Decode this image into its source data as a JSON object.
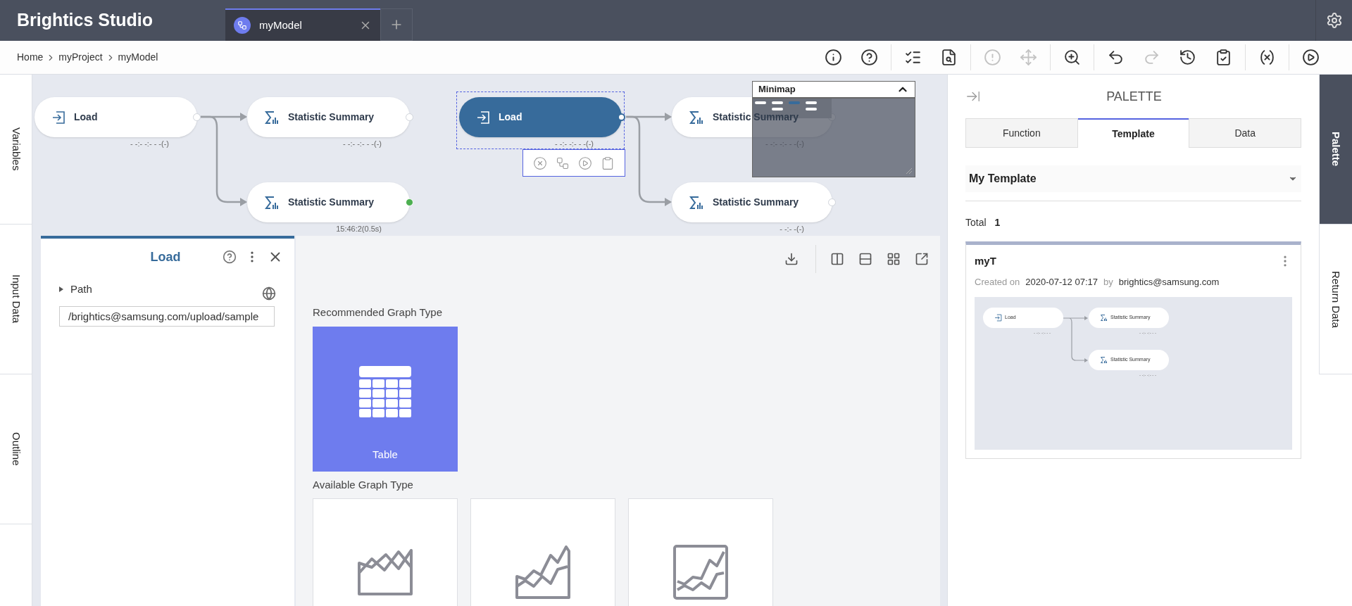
{
  "app": {
    "title": "Brightics Studio"
  },
  "tabs": [
    {
      "label": "myModel",
      "selected": true
    }
  ],
  "breadcrumb": [
    "Home",
    "myProject",
    "myModel"
  ],
  "toolbar": [
    [
      {
        "kind": "info",
        "disabled": false
      },
      {
        "kind": "help",
        "disabled": false
      }
    ],
    [
      {
        "kind": "checklist",
        "disabled": false
      },
      {
        "kind": "inspect",
        "disabled": false
      }
    ],
    [
      {
        "kind": "alert",
        "disabled": true
      },
      {
        "kind": "move",
        "disabled": true
      }
    ],
    [
      {
        "kind": "zoom",
        "disabled": false
      }
    ],
    [
      {
        "kind": "undo",
        "disabled": false
      },
      {
        "kind": "redo",
        "disabled": true
      },
      {
        "kind": "history",
        "disabled": false
      },
      {
        "kind": "clipboard",
        "disabled": false
      }
    ],
    [
      {
        "kind": "variable",
        "disabled": false
      }
    ],
    [
      {
        "kind": "run",
        "disabled": false
      }
    ]
  ],
  "left_tabs": [
    {
      "label": "Variables",
      "selected": false
    },
    {
      "label": "Input Data",
      "selected": false
    },
    {
      "label": "Outline",
      "selected": false
    }
  ],
  "right_tabs": [
    {
      "label": "Palette",
      "selected": true
    },
    {
      "label": "Return Data",
      "selected": false
    }
  ],
  "canvas": {
    "nodes": [
      {
        "kind": "load",
        "label": "Load",
        "time": "- -:- -:- - -(-)",
        "selected": false,
        "executed": false
      },
      {
        "kind": "statistic",
        "label": "Statistic Summary",
        "time": "- -:- -:- - -(-)",
        "selected": false,
        "executed": false
      },
      {
        "kind": "statistic",
        "label": "Statistic Summary",
        "time": "15:46:2(0.5s)",
        "selected": false,
        "executed": true
      },
      {
        "kind": "load",
        "label": "Load",
        "time": "- -:- -:- - -(-)",
        "selected": true,
        "executed": false
      },
      {
        "kind": "statistic",
        "label": "Statistic Summary",
        "time": "- -:- -:- - -(-)",
        "selected": false,
        "executed": false
      },
      {
        "kind": "statistic",
        "label": "Statistic Summary",
        "time": "- -:- -(-)",
        "selected": false,
        "executed": false
      }
    ],
    "minimap": {
      "title": "Minimap",
      "expanded": true
    }
  },
  "panel": {
    "title": "Load",
    "parameters": [
      {
        "label": "Path",
        "expanded": false,
        "value": "/brightics@samsung.com/upload/sample"
      }
    ]
  },
  "graphs": {
    "recommended_title": "Recommended Graph Type",
    "recommended": [
      {
        "kind": "table",
        "label": "Table",
        "selected": true
      }
    ],
    "available_title": "Available Graph Type",
    "available": [
      {
        "kind": "area",
        "selected": false
      },
      {
        "kind": "line_area",
        "selected": false
      },
      {
        "kind": "line",
        "selected": false
      }
    ]
  },
  "palette": {
    "title": "PALETTE",
    "tabs": [
      {
        "label": "Function",
        "selected": false
      },
      {
        "label": "Template",
        "selected": true
      },
      {
        "label": "Data",
        "selected": false
      }
    ],
    "category": "My Template",
    "total_label": "Total",
    "total": "1",
    "templates": [
      {
        "name": "myT",
        "created_label": "Created on",
        "created": "2020-07-12 07:17",
        "by_label": "by",
        "author": "brightics@samsung.com",
        "preview": [
          {
            "kind": "load",
            "label": "Load",
            "time": "- -:- -:- - -"
          },
          {
            "kind": "statistic",
            "label": "Statistic Summary",
            "time": "- -:- -:- - -"
          },
          {
            "kind": "statistic",
            "label": "Statistic Summary",
            "time": "- -:- -:- - -"
          }
        ]
      }
    ]
  }
}
